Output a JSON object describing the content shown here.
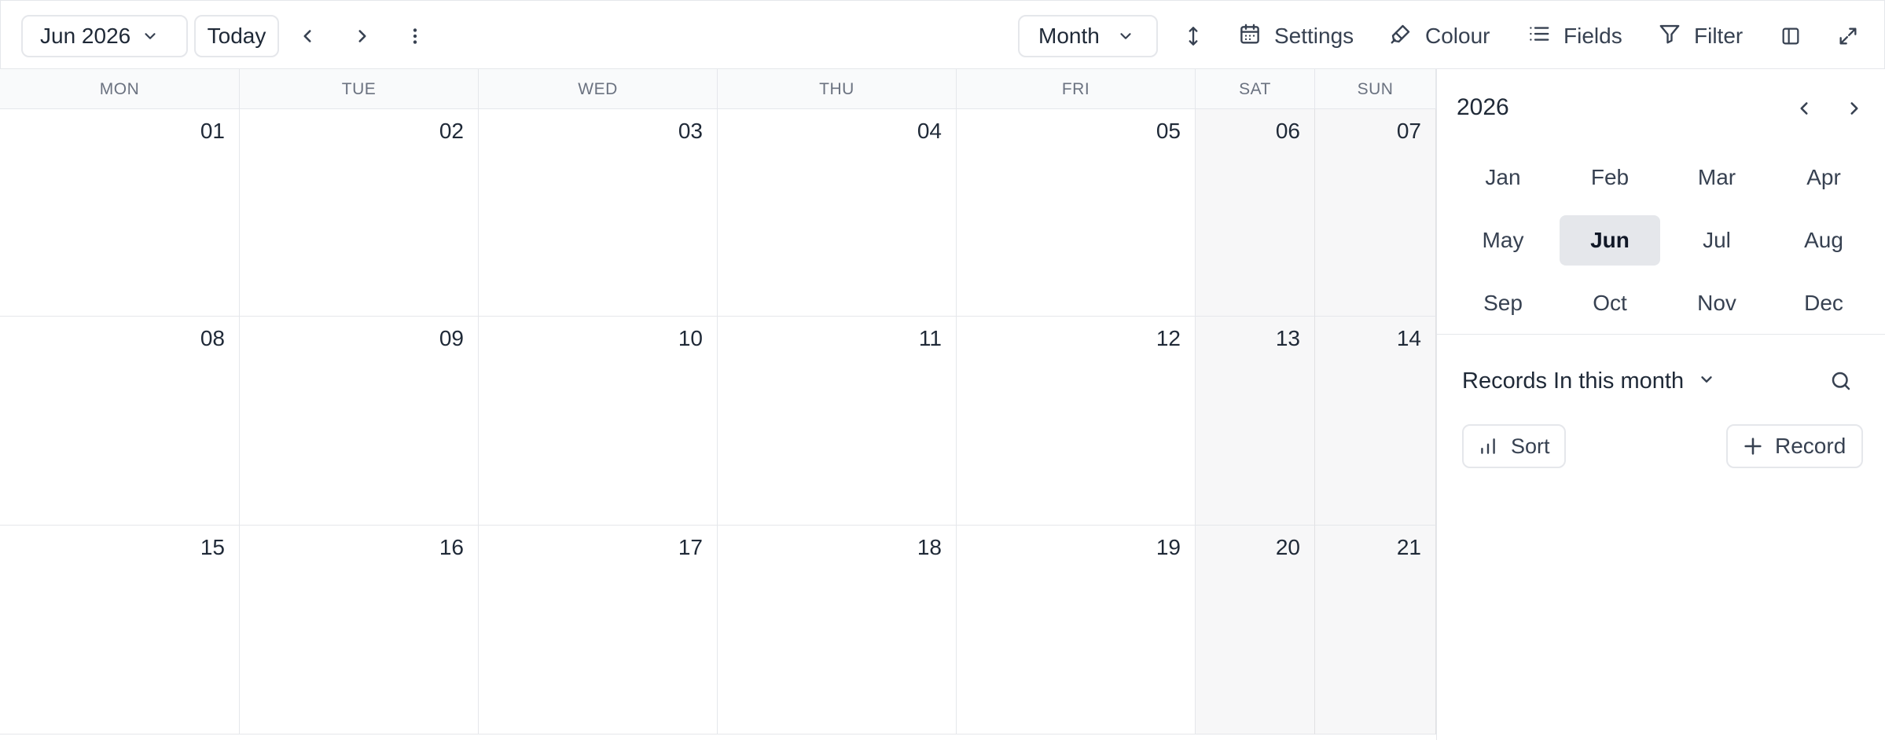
{
  "toolbar": {
    "period_label": "Jun 2026",
    "today_label": "Today",
    "view_label": "Month",
    "settings_label": "Settings",
    "colour_label": "Colour",
    "fields_label": "Fields",
    "filter_label": "Filter"
  },
  "calendar": {
    "weekdays": [
      "MON",
      "TUE",
      "WED",
      "THU",
      "FRI",
      "SAT",
      "SUN"
    ],
    "weeks": [
      [
        "01",
        "02",
        "03",
        "04",
        "05",
        "06",
        "07"
      ],
      [
        "08",
        "09",
        "10",
        "11",
        "12",
        "13",
        "14"
      ],
      [
        "15",
        "16",
        "17",
        "18",
        "19",
        "20",
        "21"
      ]
    ]
  },
  "side_panel": {
    "year": "2026",
    "months": [
      "Jan",
      "Feb",
      "Mar",
      "Apr",
      "May",
      "Jun",
      "Jul",
      "Aug",
      "Sep",
      "Oct",
      "Nov",
      "Dec"
    ],
    "selected_month": "Jun",
    "records_label": "Records In this month",
    "sort_label": "Sort",
    "add_record_label": "Record"
  }
}
